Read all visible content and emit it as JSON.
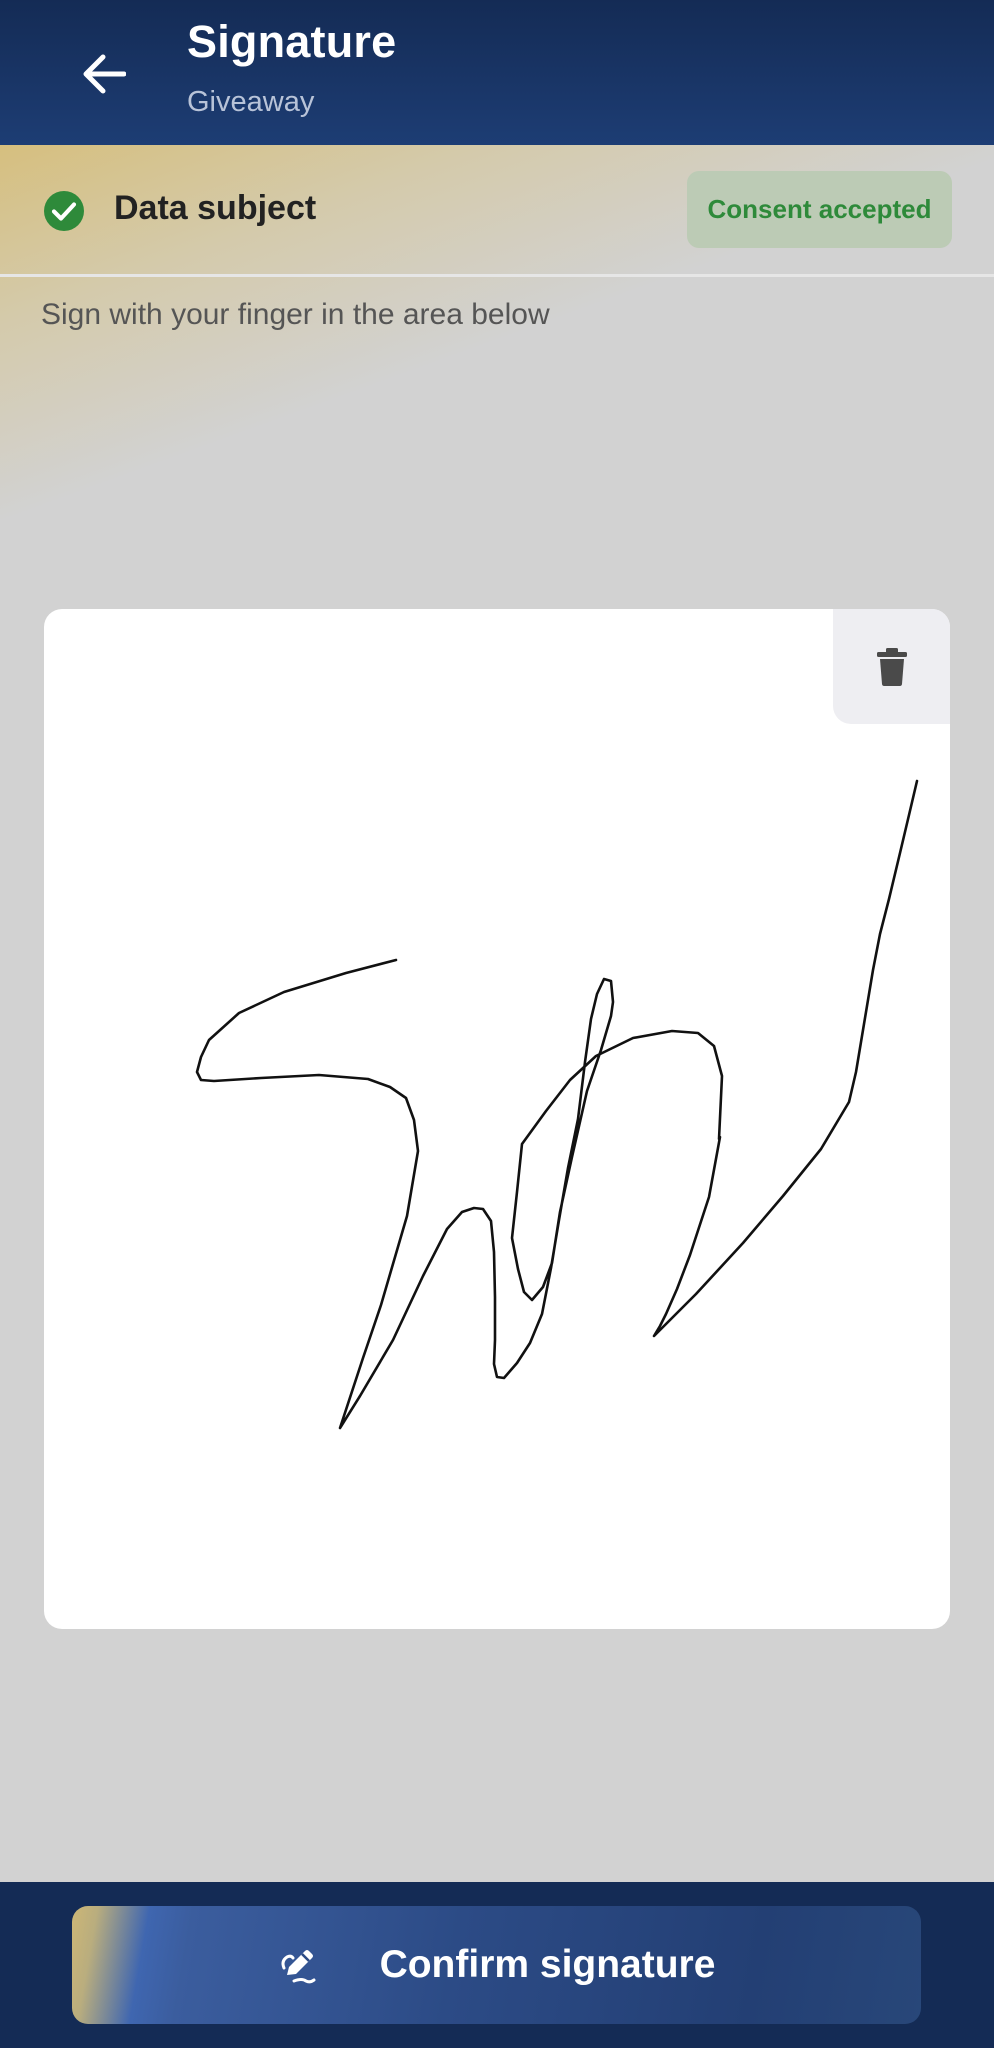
{
  "header": {
    "title": "Signature",
    "subtitle": "Giveaway",
    "back_icon": "arrow-left-icon"
  },
  "subject": {
    "label": "Data subject",
    "status_icon": "check-circle-icon",
    "badge": "Consent accepted"
  },
  "instruction": "Sign with your finger in the area below",
  "signature_pad": {
    "clear_icon": "trash-icon",
    "has_signature": true
  },
  "footer": {
    "confirm_label": "Confirm signature",
    "confirm_icon": "signature-pen-icon"
  },
  "colors": {
    "header_bg": "#142b55",
    "success_green": "#2e8a3a",
    "badge_bg": "#bccbb5",
    "page_bg": "#d2d2d2"
  }
}
